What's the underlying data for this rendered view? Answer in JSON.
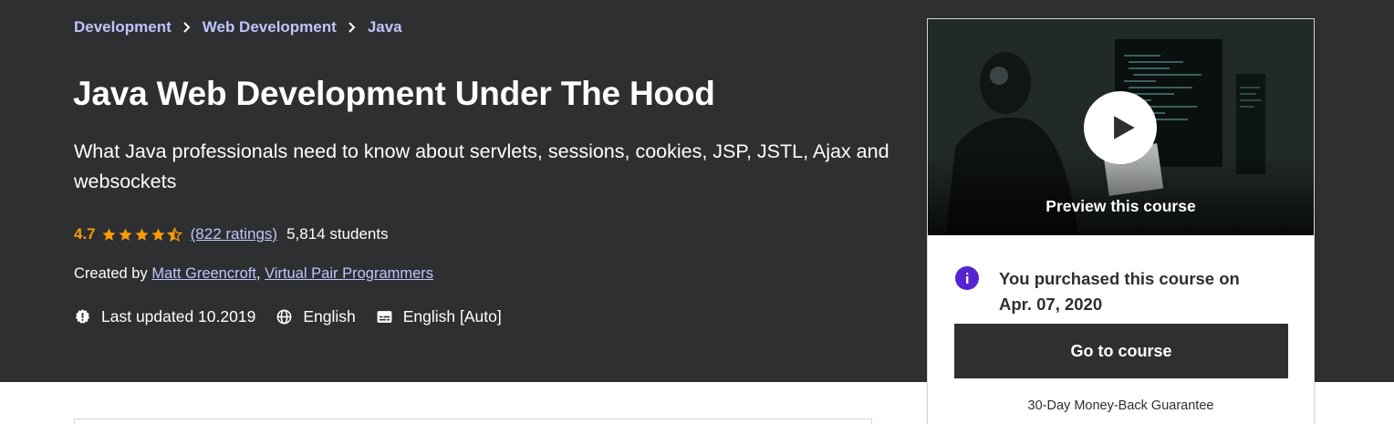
{
  "breadcrumb": {
    "items": [
      "Development",
      "Web Development",
      "Java"
    ]
  },
  "course": {
    "title": "Java Web Development Under The Hood",
    "subtitle": "What Java professionals need to know about servlets, sessions, cookies, JSP, JSTL, Ajax and websockets",
    "rating": "4.7",
    "stars_value": 4.7,
    "stars_max": 5,
    "ratings_count": "(822 ratings)",
    "students": "5,814 students",
    "created_by_label": "Created by",
    "instructors": [
      "Matt Greencroft",
      "Virtual Pair Programmers"
    ],
    "last_updated": "Last updated 10.2019",
    "language": "English",
    "captions": "English [Auto]"
  },
  "card": {
    "preview_label": "Preview this course",
    "purchased_text": "You purchased this course on Apr. 07, 2020",
    "go_button": "Go to course",
    "guarantee": "30-Day Money-Back Guarantee"
  },
  "colors": {
    "hero_bg": "#2d2f31",
    "link": "#c0c4fc",
    "rating": "#f69c08",
    "info_icon": "#5624d0"
  }
}
